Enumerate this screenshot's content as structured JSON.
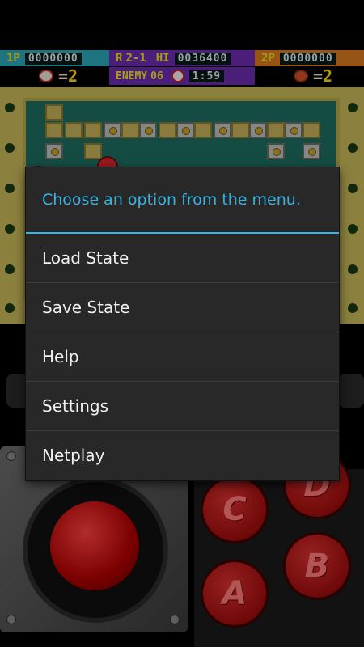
{
  "game": {
    "hud": {
      "p1_label": "1P",
      "p1_score": "0000000",
      "round_label": "R",
      "round_value": "2-1",
      "hi_label": "HI",
      "hi_score": "0036400",
      "p2_label": "2P",
      "p2_score": "0000000",
      "p1_lives_sep": "=",
      "p1_lives": "2",
      "enemy_label": "ENEMY",
      "enemy_count": "06",
      "timer": "1:59",
      "p2_lives_sep": "=",
      "p2_lives": "2"
    }
  },
  "controller": {
    "buttons": [
      "C",
      "D",
      "A",
      "B"
    ]
  },
  "dialog": {
    "title": "Choose an option from the menu.",
    "items": [
      "Load State",
      "Save State",
      "Help",
      "Settings",
      "Netplay"
    ],
    "accent_color": "#33b5e5"
  }
}
